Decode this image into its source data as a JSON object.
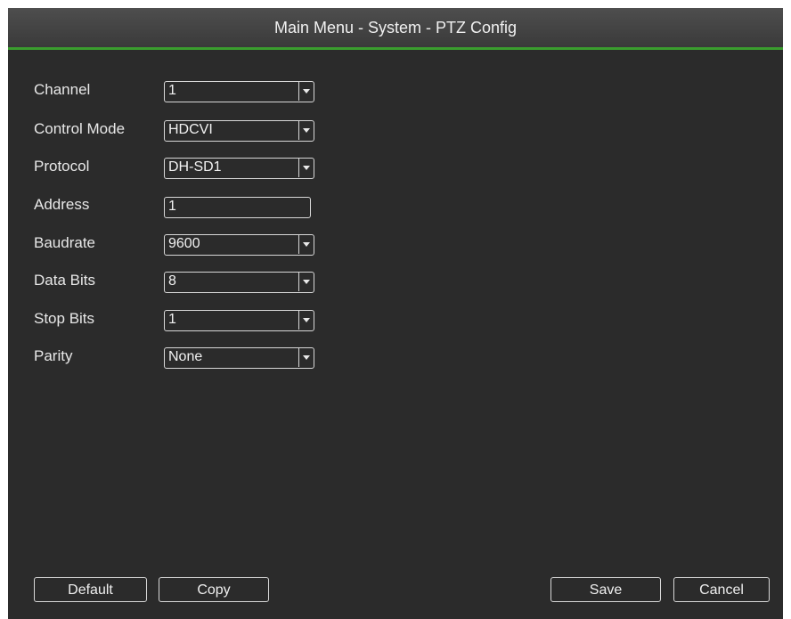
{
  "window": {
    "title": "Main Menu - System - PTZ Config"
  },
  "fields": {
    "channel": {
      "label": "Channel",
      "value": "1"
    },
    "control_mode": {
      "label": "Control Mode",
      "value": "HDCVI"
    },
    "protocol": {
      "label": "Protocol",
      "value": "DH-SD1"
    },
    "address": {
      "label": "Address",
      "value": "1"
    },
    "baudrate": {
      "label": "Baudrate",
      "value": "9600"
    },
    "data_bits": {
      "label": "Data Bits",
      "value": "8"
    },
    "stop_bits": {
      "label": "Stop Bits",
      "value": "1"
    },
    "parity": {
      "label": "Parity",
      "value": "None"
    }
  },
  "buttons": {
    "default_label": "Default",
    "copy_label": "Copy",
    "save_label": "Save",
    "cancel_label": "Cancel"
  },
  "colors": {
    "background": "#2b2b2b",
    "title_bar": "#454545",
    "accent_green": "#3a9d2e",
    "text": "#ececec"
  }
}
